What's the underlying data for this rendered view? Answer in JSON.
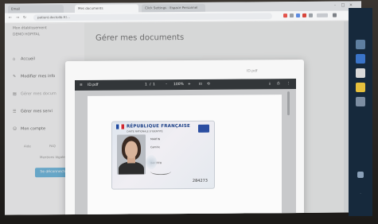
{
  "browser": {
    "tabs": [
      {
        "label": "Email"
      },
      {
        "label": "Mes documents"
      },
      {
        "label": "Click Settings - Espace Personnel"
      }
    ],
    "url": "patient.doctolib.fr/..."
  },
  "sidebar": {
    "account_label": "Mon établissement",
    "org_label": "DEMO HOPITAL",
    "items": [
      {
        "label": "Accueil",
        "icon": "home-icon"
      },
      {
        "label": "Modifier mes info",
        "icon": "edit-icon"
      },
      {
        "label": "Gérer mes docum",
        "icon": "document-icon"
      },
      {
        "label": "Gérer mes servi",
        "icon": "services-icon"
      },
      {
        "label": "Mon compte",
        "icon": "user-icon"
      }
    ],
    "footer_links": [
      "Aide",
      "FAQ"
    ],
    "footer_note": "Mentions légales",
    "cta_label": "Se déconnecter"
  },
  "main": {
    "title": "Gérer mes documents"
  },
  "modal": {
    "file_label": "ID.pdf",
    "pdf": {
      "file_name": "ID.pdf",
      "page_current": "1",
      "page_total": "1",
      "zoom": "100%"
    },
    "id_card": {
      "country": "RÉPUBLIQUE FRANÇAISE",
      "doc_type": "CARTE NATIONALE D'IDENTITÉ",
      "surname": "MARTIN",
      "given_names": "Camille",
      "number": "X4RTFFH",
      "short_code": "284273"
    }
  }
}
